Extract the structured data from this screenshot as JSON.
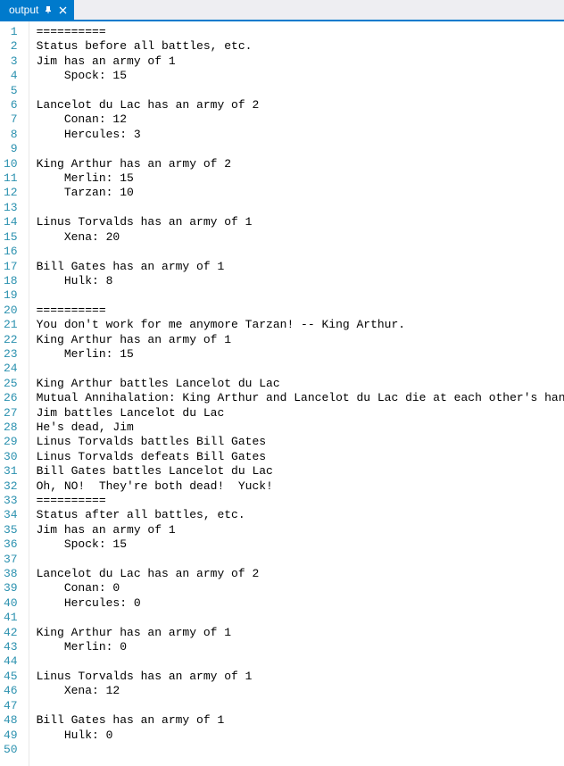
{
  "tab": {
    "title": "output",
    "pin_icon": "⊓",
    "close_icon": "✕"
  },
  "lines": [
    "==========",
    "Status before all battles, etc.",
    "Jim has an army of 1",
    "    Spock: 15",
    "",
    "Lancelot du Lac has an army of 2",
    "    Conan: 12",
    "    Hercules: 3",
    "",
    "King Arthur has an army of 2",
    "    Merlin: 15",
    "    Tarzan: 10",
    "",
    "Linus Torvalds has an army of 1",
    "    Xena: 20",
    "",
    "Bill Gates has an army of 1",
    "    Hulk: 8",
    "",
    "==========",
    "You don't work for me anymore Tarzan! -- King Arthur.",
    "King Arthur has an army of 1",
    "    Merlin: 15",
    "",
    "King Arthur battles Lancelot du Lac",
    "Mutual Annihalation: King Arthur and Lancelot du Lac die at each other's hands",
    "Jim battles Lancelot du Lac",
    "He's dead, Jim",
    "Linus Torvalds battles Bill Gates",
    "Linus Torvalds defeats Bill Gates",
    "Bill Gates battles Lancelot du Lac",
    "Oh, NO!  They're both dead!  Yuck!",
    "==========",
    "Status after all battles, etc.",
    "Jim has an army of 1",
    "    Spock: 15",
    "",
    "Lancelot du Lac has an army of 2",
    "    Conan: 0",
    "    Hercules: 0",
    "",
    "King Arthur has an army of 1",
    "    Merlin: 0",
    "",
    "Linus Torvalds has an army of 1",
    "    Xena: 12",
    "",
    "Bill Gates has an army of 1",
    "    Hulk: 0",
    ""
  ]
}
